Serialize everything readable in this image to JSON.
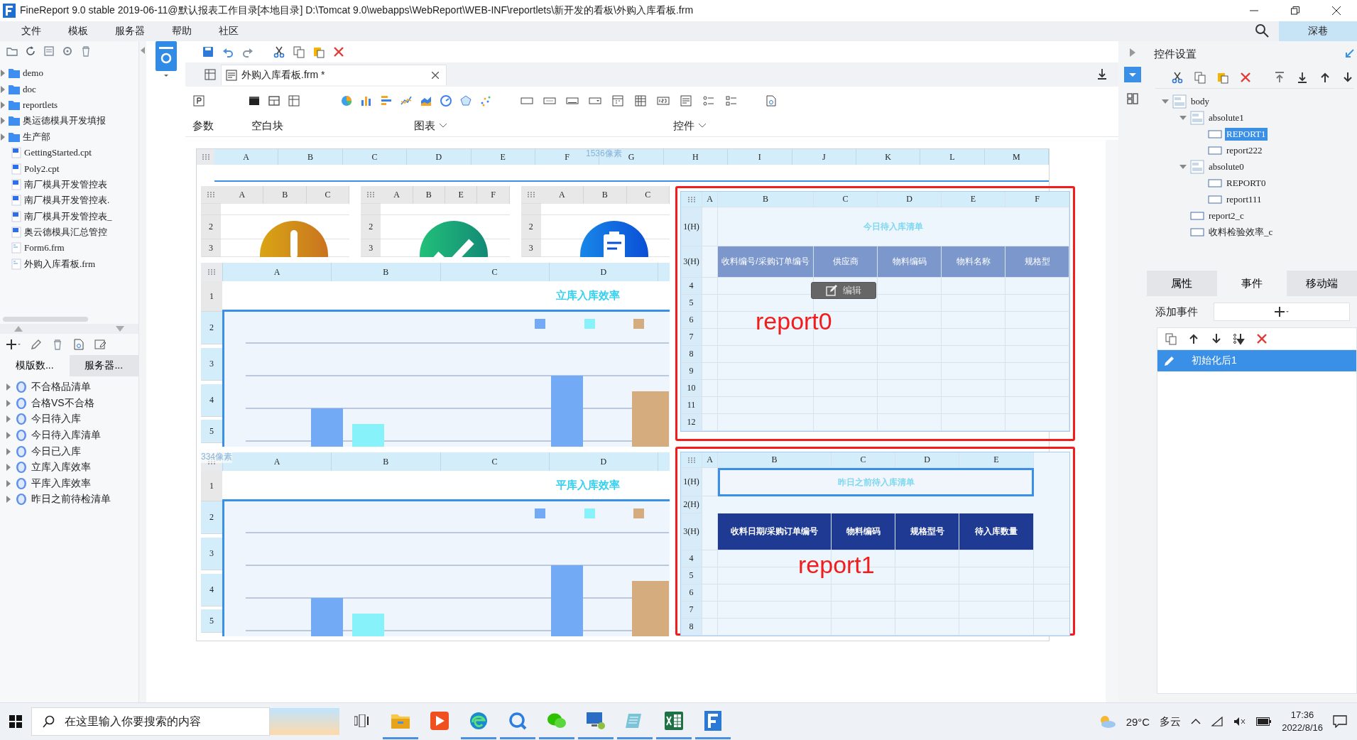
{
  "window": {
    "title": "FineReport 9.0 stable 2019-06-11@默认报表工作目录[本地目录]   D:\\Tomcat 9.0\\webapps\\WebReport\\WEB-INF\\reportlets\\新开发的看板\\外购入库看板.frm"
  },
  "menu": [
    "文件",
    "模板",
    "服务器",
    "帮助",
    "社区"
  ],
  "user": "深巷",
  "file_tree": [
    {
      "label": "demo",
      "kind": "folder"
    },
    {
      "label": "doc",
      "kind": "folder"
    },
    {
      "label": "reportlets",
      "kind": "folder"
    },
    {
      "label": "奥运德模具开发填报",
      "kind": "folder"
    },
    {
      "label": "生产部",
      "kind": "folder"
    },
    {
      "label": "GettingStarted.cpt",
      "kind": "report"
    },
    {
      "label": "Poly2.cpt",
      "kind": "report"
    },
    {
      "label": "南厂模具开发管控表",
      "kind": "report"
    },
    {
      "label": "南厂模具开发管控表.",
      "kind": "report"
    },
    {
      "label": "南厂模具开发管控表_",
      "kind": "report"
    },
    {
      "label": "奥云德模具汇总管控",
      "kind": "report"
    },
    {
      "label": "Form6.frm",
      "kind": "form"
    },
    {
      "label": "外购入库看板.frm",
      "kind": "form"
    }
  ],
  "data_tabs": [
    {
      "label": "模版数...",
      "selected": true
    },
    {
      "label": "服务器...",
      "selected": false
    }
  ],
  "datasets": [
    "不合格品清单",
    "合格VS不合格",
    "今日待入库",
    "今日待入库清单",
    "今日已入库",
    "立库入库效率",
    "平库入库效率",
    "昨日之前待检清单"
  ],
  "editor_tab": {
    "label": "外购入库看板.frm *"
  },
  "ribbon_groups": [
    "参数",
    "空白块",
    "图表",
    "控件"
  ],
  "canvas": {
    "columns": [
      "A",
      "B",
      "C",
      "D",
      "E",
      "F",
      "G",
      "H",
      "I",
      "J",
      "K",
      "L",
      "M"
    ],
    "width_hint": "1536像素",
    "height_hint": "334像素",
    "widgets": [
      {
        "kind": "warning",
        "columns": [
          "A",
          "B",
          "C"
        ],
        "rows": [
          "2",
          "3"
        ]
      },
      {
        "kind": "check",
        "columns": [
          "A",
          "B",
          "E",
          "F"
        ],
        "rows": [
          "2",
          "3"
        ]
      },
      {
        "kind": "clipboard",
        "columns": [
          "A",
          "B",
          "C"
        ],
        "rows": [
          "2",
          "3"
        ]
      }
    ],
    "charts": [
      {
        "title": "立库入库效率",
        "columns": [
          "A",
          "B",
          "C",
          "D"
        ],
        "rows": [
          "1",
          "2",
          "3",
          "4",
          "5"
        ]
      },
      {
        "title": "平库入库效率",
        "columns": [
          "A",
          "B",
          "C",
          "D"
        ],
        "rows": [
          "1",
          "2",
          "3",
          "4",
          "5"
        ]
      }
    ],
    "reports": [
      {
        "name": "report0",
        "kind": "light",
        "title": "今日待入库清单",
        "columns": [
          "A",
          "B",
          "C",
          "D",
          "E",
          "F"
        ],
        "headers": [
          "收料编号/采购订单编号",
          "供应商",
          "物料编码",
          "物料名称",
          "规格型"
        ],
        "rows": [
          {
            "label": "1(H)",
            "kind": "title"
          },
          {
            "label": "3(H)",
            "kind": "header"
          },
          {
            "label": "4",
            "kind": "blank"
          },
          {
            "label": "5",
            "kind": "blank"
          },
          {
            "label": "6",
            "kind": "blank"
          },
          {
            "label": "7",
            "kind": "blank"
          },
          {
            "label": "8",
            "kind": "blank"
          },
          {
            "label": "9",
            "kind": "blank"
          },
          {
            "label": "10",
            "kind": "blank"
          },
          {
            "label": "11",
            "kind": "blank"
          },
          {
            "label": "12",
            "kind": "blank"
          }
        ],
        "edit_button": "编辑"
      },
      {
        "name": "report1",
        "kind": "dark",
        "title": "昨日之前待入库清单",
        "columns": [
          "A",
          "B",
          "C",
          "D",
          "E"
        ],
        "headers": [
          "收料日期/采购订单编号",
          "物料编码",
          "规格型号",
          "待入库数量"
        ],
        "rows": [
          {
            "label": "1(H)",
            "kind": "title"
          },
          {
            "label": "2(H)",
            "kind": "blank"
          },
          {
            "label": "3(H)",
            "kind": "header"
          },
          {
            "label": "4",
            "kind": "blank"
          },
          {
            "label": "5",
            "kind": "blank"
          },
          {
            "label": "6",
            "kind": "blank"
          },
          {
            "label": "7",
            "kind": "blank"
          },
          {
            "label": "8",
            "kind": "blank"
          }
        ]
      }
    ]
  },
  "widget_panel": {
    "title": "控件设置",
    "tree": [
      {
        "label": "body",
        "expanded": true,
        "selected": false,
        "children": [
          {
            "label": "absolute1",
            "expanded": true,
            "selected": false,
            "children": [
              {
                "label": "REPORT1",
                "selected": true
              },
              {
                "label": "report222",
                "selected": false
              }
            ]
          },
          {
            "label": "absolute0",
            "expanded": true,
            "selected": false,
            "children": [
              {
                "label": "REPORT0",
                "selected": false
              },
              {
                "label": "report111",
                "selected": false
              }
            ]
          },
          {
            "label": "report2_c",
            "selected": false
          },
          {
            "label": "收料检验效率_c",
            "selected": false
          }
        ]
      }
    ],
    "tabs": [
      {
        "label": "属性",
        "selected": false
      },
      {
        "label": "事件",
        "selected": true
      },
      {
        "label": "移动端",
        "selected": false
      }
    ],
    "add_event_label": "添加事件",
    "events": [
      {
        "label": "初始化后1",
        "selected": true
      }
    ]
  },
  "taskbar": {
    "search_placeholder": "在这里输入你要搜索的内容",
    "apps": [
      {
        "kind": "taskview",
        "running": false
      },
      {
        "kind": "folder",
        "running": true
      },
      {
        "kind": "play",
        "running": false
      },
      {
        "kind": "browser",
        "running": true
      },
      {
        "kind": "search-bubble",
        "running": true
      },
      {
        "kind": "chat",
        "running": true
      },
      {
        "kind": "monitor",
        "running": true
      },
      {
        "kind": "notepad",
        "running": true
      },
      {
        "kind": "spreadsheet",
        "running": true
      },
      {
        "kind": "logo",
        "running": true
      }
    ],
    "weather": "29°C",
    "condition": "多云",
    "time": "17:36",
    "date": "2022/8/16"
  }
}
